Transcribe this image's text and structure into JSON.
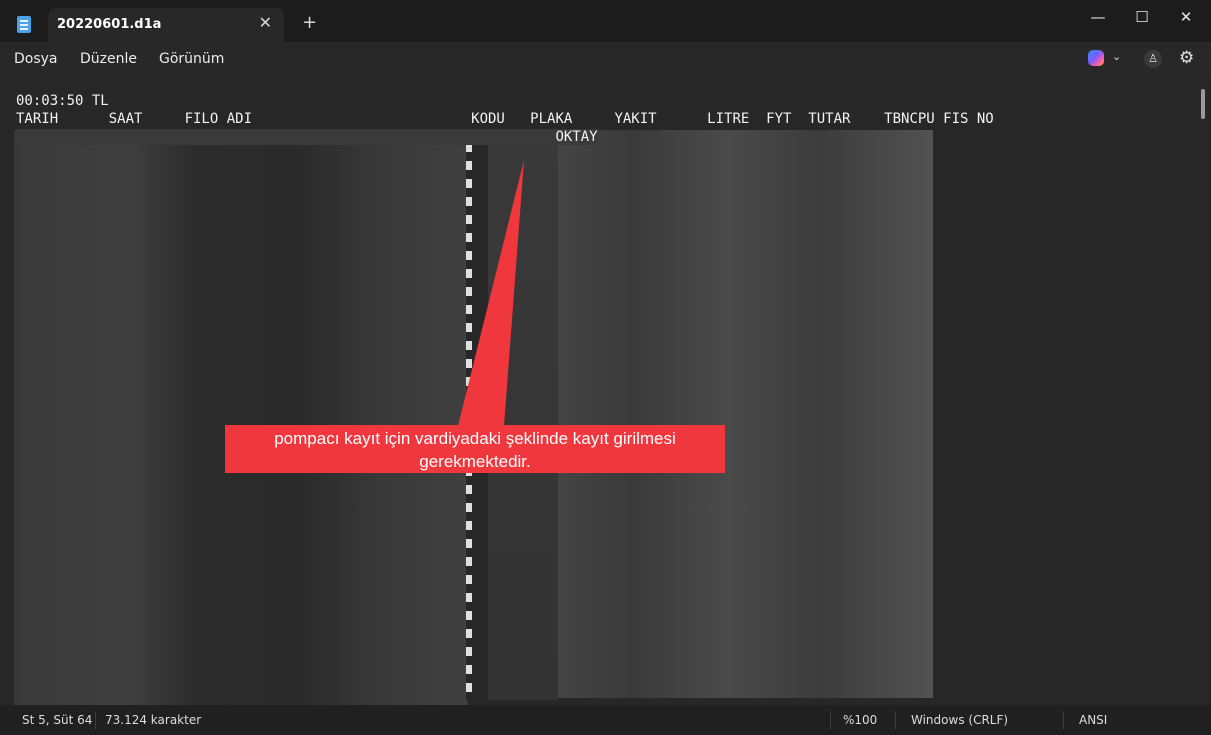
{
  "window": {
    "tab_title": "20220601.d1a",
    "tab_close": "✕",
    "new_tab": "+",
    "minimize": "—",
    "maximize": "☐",
    "close": "✕",
    "app_icon": "notepad-icon"
  },
  "menu": {
    "items": [
      "Dosya",
      "Düzenle",
      "Görünüm"
    ],
    "right_icons": [
      "copilot-icon",
      "chevron-down-icon",
      "profile-icon",
      "gear-icon"
    ],
    "chevron": "⌄",
    "profile": "♙",
    "settings": "⚙"
  },
  "editor": {
    "lines": [
      "00:03:50 TL",
      "TARIH      SAAT     FILO ADI                          KODU   PLAKA     YAKIT      LITRE  FYT  TUTAR    TBNCPU FIS NO",
      "                                                                OKTAY"
    ],
    "redacted": true
  },
  "callout": {
    "text": "pompacı kayıt için vardiyadaki şeklinde kayıt girilmesi gerekmektedir.",
    "color": "#f0373e"
  },
  "status": {
    "position": "St 5, Süt 64",
    "char_count": "73.124 karakter",
    "zoom": "%100",
    "line_ending": "Windows (CRLF)",
    "encoding": "ANSI"
  }
}
